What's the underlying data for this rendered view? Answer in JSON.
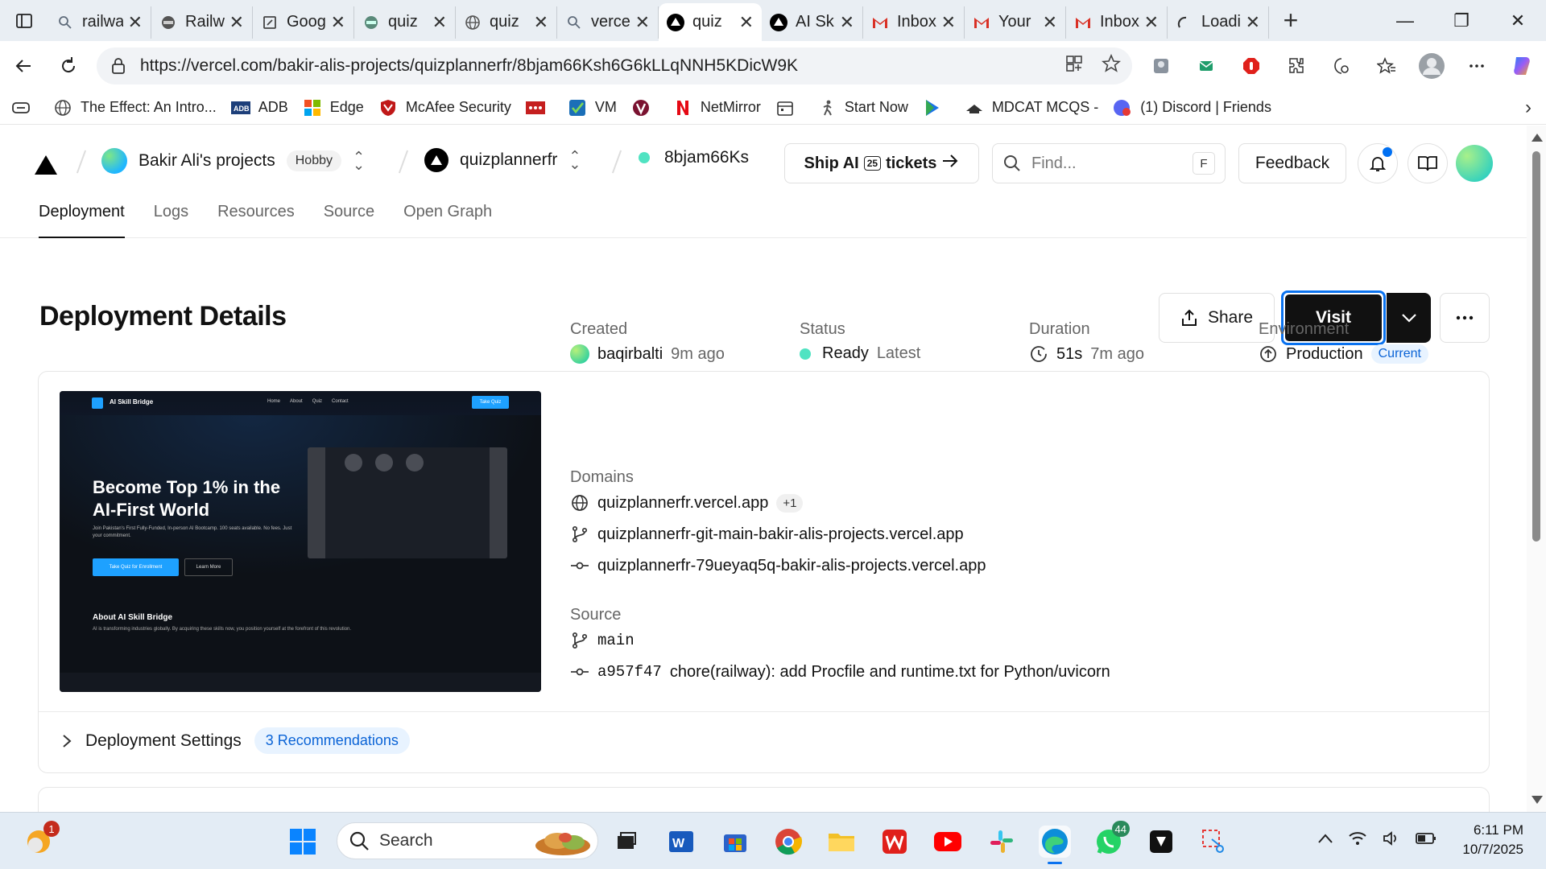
{
  "browser": {
    "tabs": [
      {
        "label": "railway",
        "icon": "search-icon"
      },
      {
        "label": "Railway",
        "icon": "railway-icon"
      },
      {
        "label": "Google",
        "icon": "doc-icon"
      },
      {
        "label": "quiz",
        "icon": "railway-icon"
      },
      {
        "label": "quiz",
        "icon": "globe-icon"
      },
      {
        "label": "vercel",
        "icon": "search-icon"
      },
      {
        "label": "quiz",
        "icon": "vercel-icon",
        "active": true
      },
      {
        "label": "AI Skill",
        "icon": "vercel-icon"
      },
      {
        "label": "Inbox",
        "icon": "gmail-icon"
      },
      {
        "label": "Your",
        "icon": "gmail-icon"
      },
      {
        "label": "Inbox",
        "icon": "gmail-icon"
      },
      {
        "label": "Loading",
        "icon": "loading-icon"
      }
    ],
    "url": "https://vercel.com/bakir-alis-projects/quizplannerfr/8bjam66Ksh6G6kLLqNNH5KDicW9K",
    "bookmarks": [
      {
        "label": "The Effect: An Intro..."
      },
      {
        "label": "ADB"
      },
      {
        "label": "Edge"
      },
      {
        "label": "McAfee Security"
      },
      {
        "label": ""
      },
      {
        "label": "VM"
      },
      {
        "label": ""
      },
      {
        "label": "NetMirror"
      },
      {
        "label": ""
      },
      {
        "label": "Start Now"
      },
      {
        "label": ""
      },
      {
        "label": "MDCAT MCQS -"
      },
      {
        "label": "(1) Discord | Friends"
      }
    ]
  },
  "header": {
    "team": "Bakir Ali's projects",
    "plan": "Hobby",
    "project": "quizplannerfr",
    "deployment": "8bjam66Ks",
    "ship": {
      "pre": "Ship AI",
      "num": "25",
      "post": "tickets"
    },
    "find_placeholder": "Find...",
    "find_kbd": "F",
    "feedback": "Feedback"
  },
  "subnav": [
    "Deployment",
    "Logs",
    "Resources",
    "Source",
    "Open Graph"
  ],
  "main": {
    "title": "Deployment Details",
    "share": "Share",
    "visit": "Visit",
    "preview": {
      "brand": "AI Skill Bridge",
      "links": [
        "Home",
        "About",
        "Quiz",
        "Contact"
      ],
      "cta": "Take Quiz",
      "headline": "Become Top 1% in the AI-First World",
      "sub": "Join Pakistan's First Fully-Funded, In-person AI Bootcamp. 100 seats available. No fees. Just your commitment.",
      "btn1": "Take Quiz for Enrollment",
      "btn2": "Learn More",
      "about_title": "About AI Skill Bridge",
      "about_text": "AI is transforming industries globally. By acquiring these skills now, you position yourself at the forefront of this revolution."
    },
    "created": {
      "label": "Created",
      "user": "baqirbalti",
      "time": "9m ago"
    },
    "status": {
      "label": "Status",
      "value": "Ready",
      "tag": "Latest"
    },
    "duration": {
      "label": "Duration",
      "value": "51s",
      "time": "7m ago"
    },
    "environment": {
      "label": "Environment",
      "value": "Production",
      "badge": "Current"
    },
    "domains": {
      "label": "Domains",
      "primary": "quizplannerfr.vercel.app",
      "extra": "+1",
      "branch": "quizplannerfr-git-main-bakir-alis-projects.vercel.app",
      "commit": "quizplannerfr-79ueyaq5q-bakir-alis-projects.vercel.app"
    },
    "source": {
      "label": "Source",
      "branch": "main",
      "sha": "a957f47",
      "message": "chore(railway): add Procfile and runtime.txt for Python/uvicorn"
    },
    "settings": {
      "label": "Deployment Settings",
      "badge": "3 Recommendations"
    }
  },
  "taskbar": {
    "search": "Search",
    "time": "6:11 PM",
    "date": "10/7/2025",
    "weather_badge": "1",
    "whatsapp_badge": "44"
  },
  "colors": {
    "accent": "#0a72ef",
    "ready": "#50e3c2",
    "badge_bg": "#e8f3ff"
  }
}
